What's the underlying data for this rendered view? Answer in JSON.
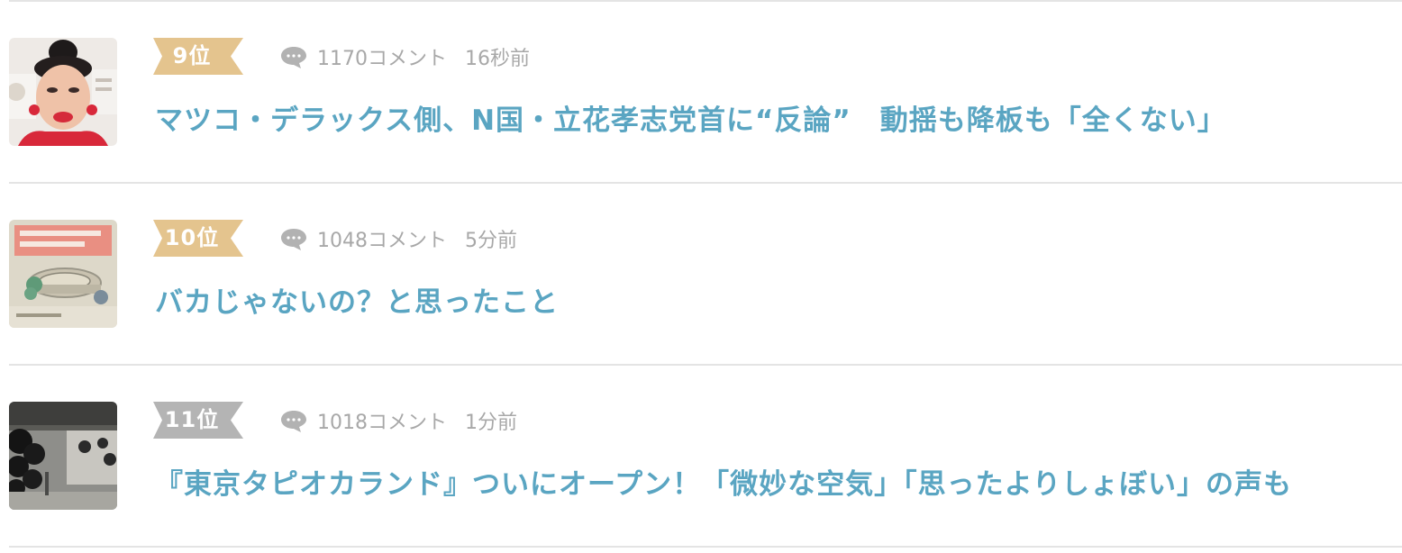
{
  "colors": {
    "title": "#5aa5c2",
    "meta": "#a8a8a8",
    "badge_gold": "#e4c48e",
    "badge_gray": "#b4b4b4",
    "divider": "#e4e4e4"
  },
  "rankings": [
    {
      "rank": "9位",
      "badge_color": "#e4c48e",
      "comments": "1170コメント",
      "time": "16秒前",
      "title": "マツコ・デラックス側、N国・立花孝志党首に“反論”　動揺も降板も「全くない」",
      "thumb_icon": "person-photo"
    },
    {
      "rank": "10位",
      "badge_color": "#e4c48e",
      "comments": "1048コメント",
      "time": "5分前",
      "title": "バカじゃないの？と思ったこと",
      "thumb_icon": "stadium-illustration"
    },
    {
      "rank": "11位",
      "badge_color": "#b4b4b4",
      "comments": "1018コメント",
      "time": "1分前",
      "title": "『東京タピオカランド』ついにオープン！「微妙な空気」「思ったよりしょぼい」の声も",
      "thumb_icon": "balloons-photo"
    }
  ]
}
